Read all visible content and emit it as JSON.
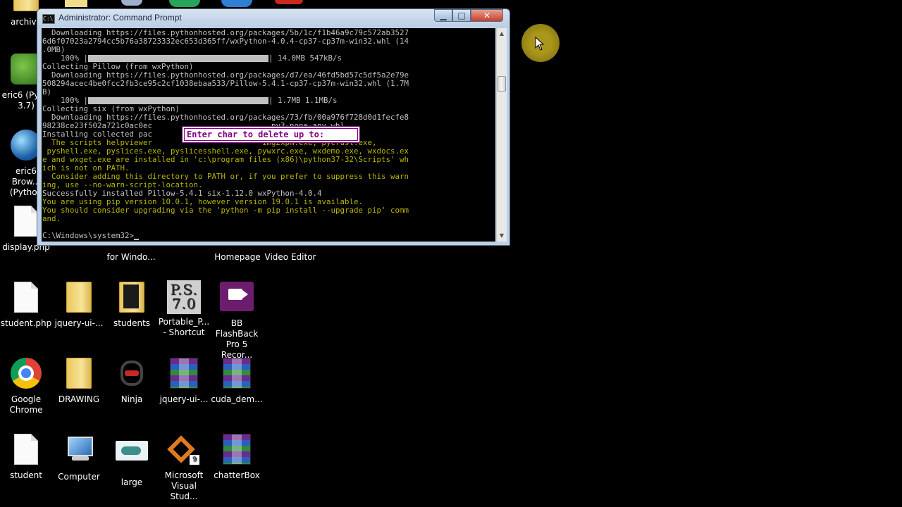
{
  "desktop": {
    "top_partial": [
      {
        "name": "archive",
        "label": "archive"
      }
    ],
    "left_column": [
      {
        "label": "eric6 (Pyt...\n3.7)"
      },
      {
        "label": "eric6 Brow...\n(Python"
      },
      {
        "label": "display.php"
      }
    ],
    "row_partial_labels": [
      {
        "label": "for Windo..."
      },
      {
        "label": "Homepage"
      },
      {
        "label": "Video Editor"
      }
    ],
    "row1": [
      {
        "label": "student.php",
        "icon": "php-file-icon"
      },
      {
        "label": "jquery-ui-...",
        "icon": "folder-icon"
      },
      {
        "label": "students",
        "icon": "folder-icon"
      },
      {
        "label": "Portable_P...\n- Shortcut",
        "icon": "ps7-shortcut-icon"
      },
      {
        "label": "BB FlashBack\nPro 5 Recor...",
        "icon": "bb-flashback-icon"
      }
    ],
    "row2": [
      {
        "label": "Google\nChrome",
        "icon": "chrome-icon"
      },
      {
        "label": "DRAWING",
        "icon": "folder-icon"
      },
      {
        "label": "Ninja",
        "icon": "ninja-icon"
      },
      {
        "label": "jquery-ui-...",
        "icon": "winrar-icon"
      },
      {
        "label": "cuda_dem...",
        "icon": "winrar-icon"
      }
    ],
    "row3": [
      {
        "label": "student",
        "icon": "document-icon"
      },
      {
        "label": "Computer",
        "icon": "computer-icon"
      },
      {
        "label": "large",
        "icon": "image-icon"
      },
      {
        "label": "Microsoft\nVisual Stud...",
        "icon": "visual-studio-icon"
      },
      {
        "label": "chatterBox",
        "icon": "winrar-icon"
      }
    ]
  },
  "cmd": {
    "title": "Administrator: Command Prompt",
    "buttons": {
      "minimize": "▁",
      "maximize": "□",
      "close": "✕"
    },
    "lines": [
      {
        "text": "  Downloading https://files.pythonhosted.org/packages/5b/1c/f1b46a9c79c572ab3527",
        "color": "g"
      },
      {
        "text": "6d6f07023a2794cc5b76a38723332ec653d365ff/wxPython-4.0.4-cp37-cp37m-win32.whl (14",
        "color": "g"
      },
      {
        "text": ".0MB)",
        "color": "g"
      },
      {
        "text": "    100% |",
        "bar": true,
        "after": "| 14.0MB 547kB/s",
        "color": "g"
      },
      {
        "text": "Collecting Pillow (from wxPython)",
        "color": "g"
      },
      {
        "text": "  Downloading https://files.pythonhosted.org/packages/d7/ea/46fd5bd57c5df5a2e79e",
        "color": "g"
      },
      {
        "text": "508294acec4be0fcc2fb3ce95c2cf1038ebaa533/Pillow-5.4.1-cp37-cp37m-win32.whl (1.7M",
        "color": "g"
      },
      {
        "text": "B)",
        "color": "g"
      },
      {
        "text": "    100% |",
        "bar": true,
        "after": "| 1.7MB 1.1MB/s",
        "color": "g"
      },
      {
        "text": "Collecting six (from wxPython)",
        "color": "g"
      },
      {
        "text": "  Downloading https://files.pythonhosted.org/packages/73/fb/00a976f728d0d1fecfe8",
        "color": "g"
      },
      {
        "text": "98238ce23f502a721c0ac0ec                          py3-none-any.whl",
        "color": "g"
      },
      {
        "text": "Installing collected pac",
        "color": "g"
      },
      {
        "text": "  The scripts helpviewer                        img2xpm.exe, pycrust.exe,",
        "color": "y"
      },
      {
        "text": " pyshell.exe, pyslices.exe, pyslicesshell.exe, pywxrc.exe, wxdemo.exe, wxdocs.ex",
        "color": "y"
      },
      {
        "text": "e and wxget.exe are installed in 'c:\\program files (x86)\\python37-32\\Scripts' wh",
        "color": "y"
      },
      {
        "text": "ich is not on PATH.",
        "color": "y"
      },
      {
        "text": "  Consider adding this directory to PATH or, if you prefer to suppress this warn",
        "color": "y"
      },
      {
        "text": "ing, use --no-warn-script-location.",
        "color": "y"
      },
      {
        "text": "Successfully installed Pillow-5.4.1 six-1.12.0 wxPython-4.0.4",
        "color": "g"
      },
      {
        "text": "You are using pip version 10.0.1, however version 19.0.1 is available.",
        "color": "y"
      },
      {
        "text": "You should consider upgrading via the 'python -m pip install --upgrade pip' comm",
        "color": "y"
      },
      {
        "text": "and.",
        "color": "y"
      },
      {
        "text": "",
        "color": "g"
      },
      {
        "text": "C:\\Windows\\system32>",
        "cursor": true,
        "color": "g"
      }
    ],
    "popup_text": "Enter char to delete up to:",
    "colors": {
      "normal": "#c0c0c0",
      "warning": "#b8b400",
      "popup": "#800080"
    }
  }
}
